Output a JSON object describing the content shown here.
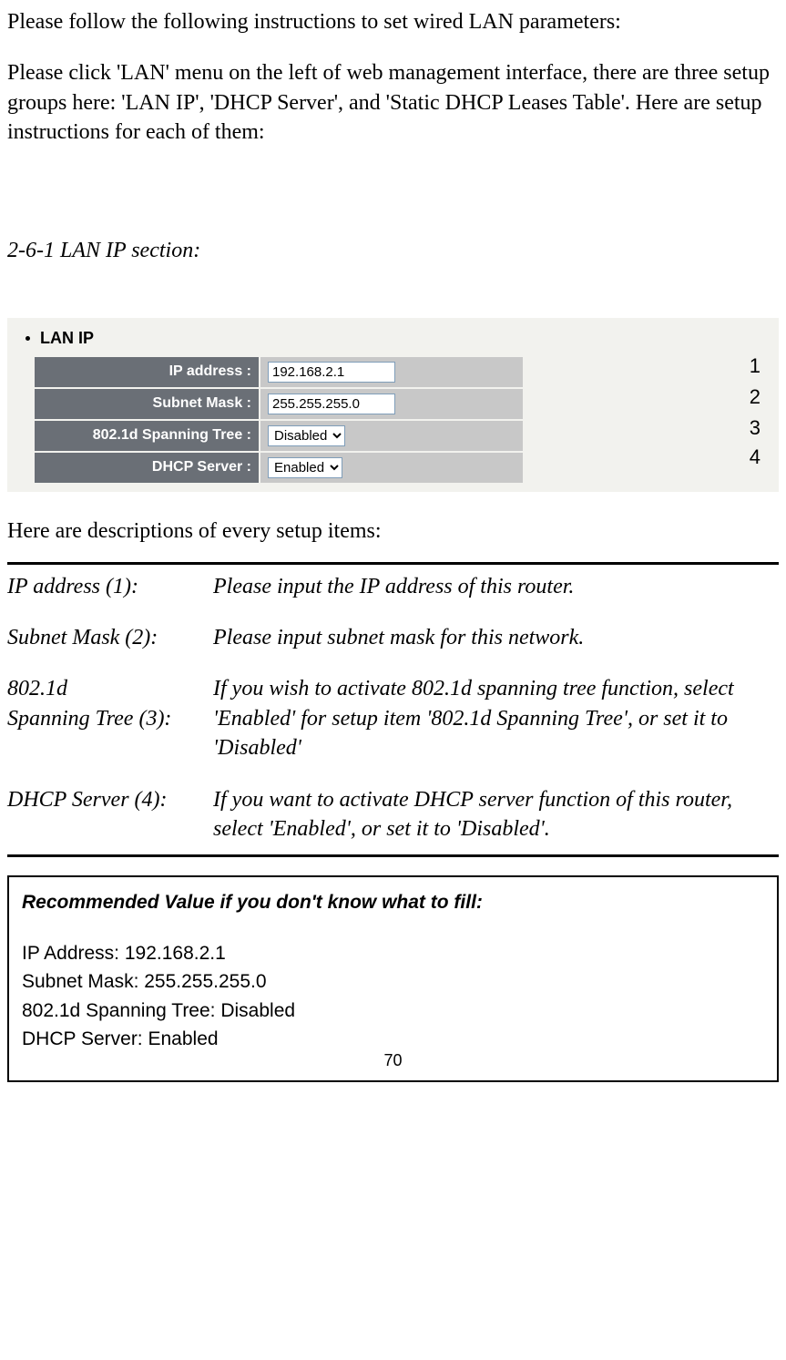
{
  "intro_para1": "Please follow the following instructions to set wired LAN parameters:",
  "intro_para2": "Please click 'LAN' menu on the left of web management interface, there are three setup groups here: 'LAN IP', 'DHCP Server', and 'Static DHCP Leases Table'. Here are setup instructions for each of them:",
  "section_heading": "2-6-1 LAN IP section:",
  "screenshot": {
    "title": "LAN IP",
    "rows": [
      {
        "label": "IP address :",
        "value": "192.168.2.1",
        "type": "text",
        "annot": "1"
      },
      {
        "label": "Subnet Mask :",
        "value": "255.255.255.0",
        "type": "text",
        "annot": "2"
      },
      {
        "label": "802.1d Spanning Tree :",
        "value": "Disabled",
        "type": "select",
        "annot": "3"
      },
      {
        "label": "DHCP Server :",
        "value": "Enabled",
        "type": "select",
        "annot": "4"
      }
    ]
  },
  "desc_intro": "Here are descriptions of every setup items:",
  "descriptions": [
    {
      "label": "IP address (1):",
      "text": "Please input the IP address of this router."
    },
    {
      "label": "Subnet Mask (2):",
      "text": "Please input subnet mask for this network."
    },
    {
      "label": "802.1d\nSpanning Tree (3):",
      "text": "If you wish to activate 802.1d spanning tree function, select 'Enabled' for setup item '802.1d Spanning Tree', or set it to 'Disabled'"
    },
    {
      "label": "DHCP Server (4):",
      "text": "If you want to activate DHCP server function of this router, select 'Enabled', or set it to 'Disabled'."
    }
  ],
  "recommended": {
    "title": "Recommended Value if you don't know what to fill:",
    "lines": [
      "IP Address: 192.168.2.1",
      "Subnet Mask: 255.255.255.0",
      "802.1d Spanning Tree: Disabled",
      "DHCP Server: Enabled"
    ]
  },
  "page_number": "70"
}
